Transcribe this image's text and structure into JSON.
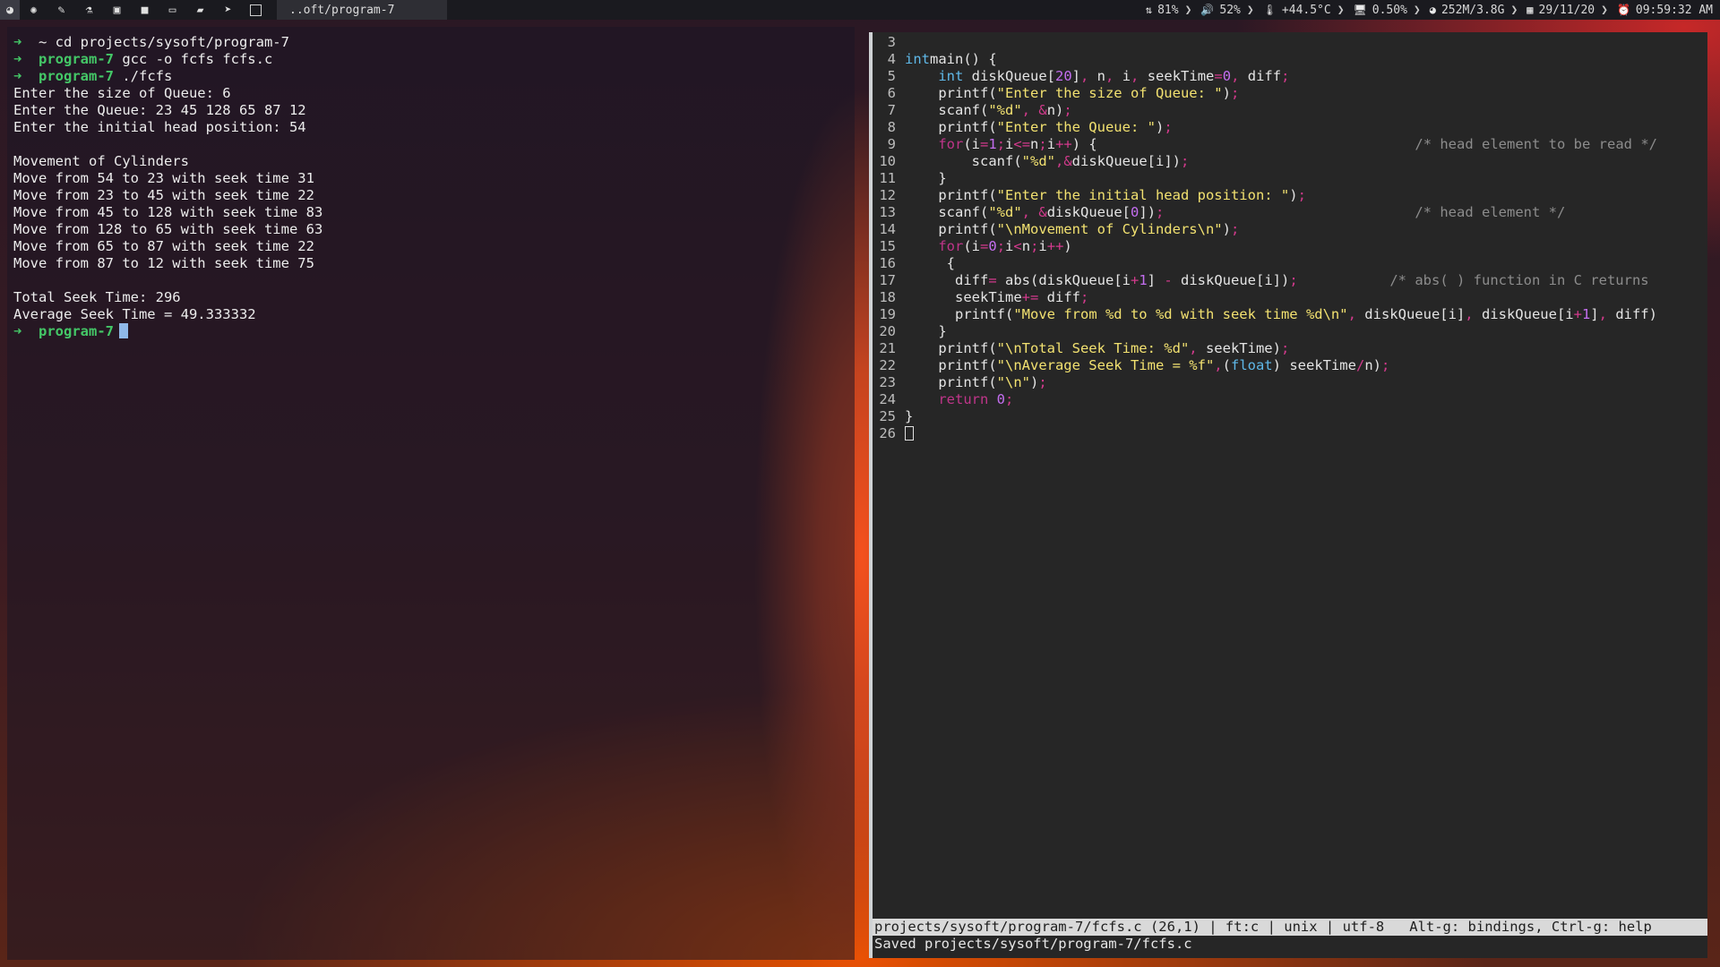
{
  "topbar": {
    "launcher_icons": [
      "app-menu-icon",
      "browser-icon",
      "pen-icon",
      "flask-icon",
      "image-icon",
      "video-icon",
      "laptop-icon",
      "folder-icon",
      "telegram-icon",
      "window-icon"
    ],
    "window_title": "..oft/program-7",
    "status": [
      {
        "icon": "network-icon",
        "glyph": "⇅",
        "value": "81%"
      },
      {
        "icon": "volume-icon",
        "glyph": "🔊",
        "value": "52%"
      },
      {
        "icon": "thermometer-icon",
        "glyph": "🌡",
        "value": "+44.5°C"
      },
      {
        "icon": "cpu-icon",
        "glyph": "🖥",
        "value": "0.50%"
      },
      {
        "icon": "memory-icon",
        "glyph": "◕",
        "value": "252M/3.8G"
      },
      {
        "icon": "calendar-icon",
        "glyph": "▦",
        "value": "29/11/20"
      },
      {
        "icon": "clock-icon",
        "glyph": "⏰",
        "value": "09:59:32 AM"
      }
    ],
    "separator": "❯"
  },
  "terminal": {
    "prompt_arrow": "➜",
    "commands": [
      {
        "dir": "~",
        "cmd": "cd projects/sysoft/program-7"
      },
      {
        "dir": "program-7",
        "cmd": "gcc -o fcfs fcfs.c"
      },
      {
        "dir": "program-7",
        "cmd": "./fcfs"
      }
    ],
    "output": [
      "Enter the size of Queue: 6",
      "Enter the Queue: 23 45 128 65 87 12",
      "Enter the initial head position: 54",
      "",
      "Movement of Cylinders",
      "Move from 54 to 23 with seek time 31",
      "Move from 23 to 45 with seek time 22",
      "Move from 45 to 128 with seek time 83",
      "Move from 128 to 65 with seek time 63",
      "Move from 65 to 87 with seek time 22",
      "Move from 87 to 12 with seek time 75",
      "",
      "Total Seek Time: 296",
      "Average Seek Time = 49.333332"
    ],
    "final_prompt_dir": "program-7"
  },
  "editor": {
    "lines": [
      {
        "n": "3",
        "t": []
      },
      {
        "n": "4",
        "t": [
          [
            "ty",
            "int"
          ],
          [
            "",
            "main() {"
          ]
        ]
      },
      {
        "n": "5",
        "t": [
          [
            "",
            "    "
          ],
          [
            "ty",
            "int"
          ],
          [
            "",
            " diskQueue["
          ],
          [
            "num",
            "20"
          ],
          [
            "",
            "]"
          ],
          [
            "op",
            ","
          ],
          [
            "",
            " n"
          ],
          [
            "op",
            ","
          ],
          [
            "",
            " i"
          ],
          [
            "op",
            ","
          ],
          [
            "",
            " seekTime"
          ],
          [
            "op",
            "="
          ],
          [
            "num",
            "0"
          ],
          [
            "op",
            ","
          ],
          [
            "",
            " diff"
          ],
          [
            "op",
            ";"
          ]
        ]
      },
      {
        "n": "6",
        "t": [
          [
            "",
            "    printf("
          ],
          [
            "str",
            "\"Enter the size of Queue: \""
          ],
          [
            "",
            ")"
          ],
          [
            "op",
            ";"
          ]
        ]
      },
      {
        "n": "7",
        "t": [
          [
            "",
            "    scanf("
          ],
          [
            "str",
            "\"%d\""
          ],
          [
            "op",
            ","
          ],
          [
            "",
            " "
          ],
          [
            "op",
            "&"
          ],
          [
            "",
            "n)"
          ],
          [
            "op",
            ";"
          ]
        ]
      },
      {
        "n": "8",
        "t": [
          [
            "",
            "    printf("
          ],
          [
            "str",
            "\"Enter the Queue: \""
          ],
          [
            "",
            ")"
          ],
          [
            "op",
            ";"
          ]
        ]
      },
      {
        "n": "9",
        "t": [
          [
            "",
            "    "
          ],
          [
            "kw",
            "for"
          ],
          [
            "",
            "(i"
          ],
          [
            "op",
            "="
          ],
          [
            "num",
            "1"
          ],
          [
            "op",
            ";"
          ],
          [
            "",
            "i"
          ],
          [
            "op",
            "<="
          ],
          [
            "",
            "n"
          ],
          [
            "op",
            ";"
          ],
          [
            "",
            "i"
          ],
          [
            "op",
            "++"
          ],
          [
            "",
            ") {                                      "
          ],
          [
            "cm",
            "/* head element to be read */"
          ]
        ]
      },
      {
        "n": "10",
        "t": [
          [
            "",
            "        scanf("
          ],
          [
            "str",
            "\"%d\""
          ],
          [
            "op",
            ","
          ],
          [
            "op",
            "&"
          ],
          [
            "",
            "diskQueue[i])"
          ],
          [
            "op",
            ";"
          ]
        ]
      },
      {
        "n": "11",
        "t": [
          [
            "",
            "    }"
          ]
        ]
      },
      {
        "n": "12",
        "t": [
          [
            "",
            "    printf("
          ],
          [
            "str",
            "\"Enter the initial head position: \""
          ],
          [
            "",
            ")"
          ],
          [
            "op",
            ";"
          ]
        ]
      },
      {
        "n": "13",
        "t": [
          [
            "",
            "    scanf("
          ],
          [
            "str",
            "\"%d\""
          ],
          [
            "op",
            ","
          ],
          [
            "",
            " "
          ],
          [
            "op",
            "&"
          ],
          [
            "",
            "diskQueue["
          ],
          [
            "num",
            "0"
          ],
          [
            "",
            "])"
          ],
          [
            "op",
            ";"
          ],
          [
            "",
            "                              "
          ],
          [
            "cm",
            "/* head element */"
          ]
        ]
      },
      {
        "n": "14",
        "t": [
          [
            "",
            "    printf("
          ],
          [
            "str",
            "\"\\nMovement of Cylinders\\n\""
          ],
          [
            "",
            ")"
          ],
          [
            "op",
            ";"
          ]
        ]
      },
      {
        "n": "15",
        "t": [
          [
            "",
            "    "
          ],
          [
            "kw",
            "for"
          ],
          [
            "",
            "(i"
          ],
          [
            "op",
            "="
          ],
          [
            "num",
            "0"
          ],
          [
            "op",
            ";"
          ],
          [
            "",
            "i"
          ],
          [
            "op",
            "<"
          ],
          [
            "",
            "n"
          ],
          [
            "op",
            ";"
          ],
          [
            "",
            "i"
          ],
          [
            "op",
            "++"
          ],
          [
            "",
            ")"
          ]
        ]
      },
      {
        "n": "16",
        "t": [
          [
            "",
            "     {"
          ]
        ]
      },
      {
        "n": "17",
        "t": [
          [
            "",
            "      diff"
          ],
          [
            "op",
            "="
          ],
          [
            "",
            " abs(diskQueue[i"
          ],
          [
            "op",
            "+"
          ],
          [
            "num",
            "1"
          ],
          [
            "",
            "] "
          ],
          [
            "op",
            "-"
          ],
          [
            "",
            " diskQueue[i])"
          ],
          [
            "op",
            ";"
          ],
          [
            "",
            "           "
          ],
          [
            "cm",
            "/* abs( ) function in C returns"
          ]
        ]
      },
      {
        "n": "18",
        "t": [
          [
            "",
            "      seekTime"
          ],
          [
            "op",
            "+="
          ],
          [
            "",
            " diff"
          ],
          [
            "op",
            ";"
          ]
        ]
      },
      {
        "n": "19",
        "t": [
          [
            "",
            "      printf("
          ],
          [
            "str",
            "\"Move from %d to %d with seek time %d\\n\""
          ],
          [
            "op",
            ","
          ],
          [
            "",
            " diskQueue[i]"
          ],
          [
            "op",
            ","
          ],
          [
            "",
            " diskQueue[i"
          ],
          [
            "op",
            "+"
          ],
          [
            "num",
            "1"
          ],
          [
            "",
            "]"
          ],
          [
            "op",
            ","
          ],
          [
            "",
            " diff)"
          ]
        ]
      },
      {
        "n": "20",
        "t": [
          [
            "",
            "    }"
          ]
        ]
      },
      {
        "n": "21",
        "t": [
          [
            "",
            "    printf("
          ],
          [
            "str",
            "\"\\nTotal Seek Time: %d\""
          ],
          [
            "op",
            ","
          ],
          [
            "",
            " seekTime)"
          ],
          [
            "op",
            ";"
          ]
        ]
      },
      {
        "n": "22",
        "t": [
          [
            "",
            "    printf("
          ],
          [
            "str",
            "\"\\nAverage Seek Time = %f\""
          ],
          [
            "op",
            ","
          ],
          [
            "",
            "("
          ],
          [
            "ty",
            "float"
          ],
          [
            "",
            ") seekTime"
          ],
          [
            "op",
            "/"
          ],
          [
            "",
            "n)"
          ],
          [
            "op",
            ";"
          ]
        ]
      },
      {
        "n": "23",
        "t": [
          [
            "",
            "    printf("
          ],
          [
            "str",
            "\"\\n\""
          ],
          [
            "",
            ")"
          ],
          [
            "op",
            ";"
          ]
        ]
      },
      {
        "n": "24",
        "t": [
          [
            "",
            "    "
          ],
          [
            "kw",
            "return"
          ],
          [
            "",
            " "
          ],
          [
            "num",
            "0"
          ],
          [
            "op",
            ";"
          ]
        ]
      },
      {
        "n": "25",
        "t": [
          [
            "",
            "}"
          ]
        ]
      },
      {
        "n": "26",
        "t": [
          [
            "cursor",
            ""
          ]
        ]
      }
    ],
    "statusline": "projects/sysoft/program-7/fcfs.c (26,1) | ft:c | unix | utf-8   Alt-g: bindings, Ctrl-g: help",
    "message": "Saved projects/sysoft/program-7/fcfs.c"
  }
}
